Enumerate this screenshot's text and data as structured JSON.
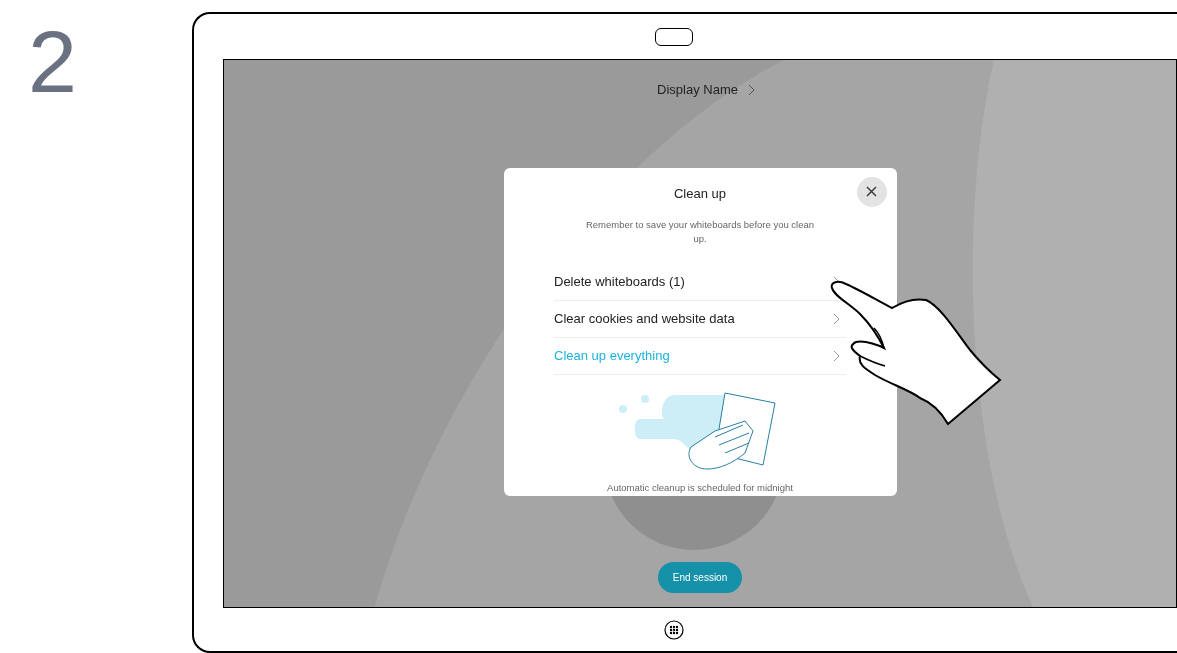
{
  "step": "2",
  "header": {
    "display_name": "Display Name"
  },
  "dialog": {
    "title": "Clean up",
    "message": "Remember to save your whiteboards before you clean up.",
    "items": [
      {
        "label": "Delete whiteboards (1)",
        "kind": "option"
      },
      {
        "label": "Clear cookies and website data",
        "kind": "option"
      },
      {
        "label": "Clean up everything",
        "kind": "action"
      }
    ],
    "footer": "Automatic cleanup is scheduled for midnight"
  },
  "end_button": "End session"
}
